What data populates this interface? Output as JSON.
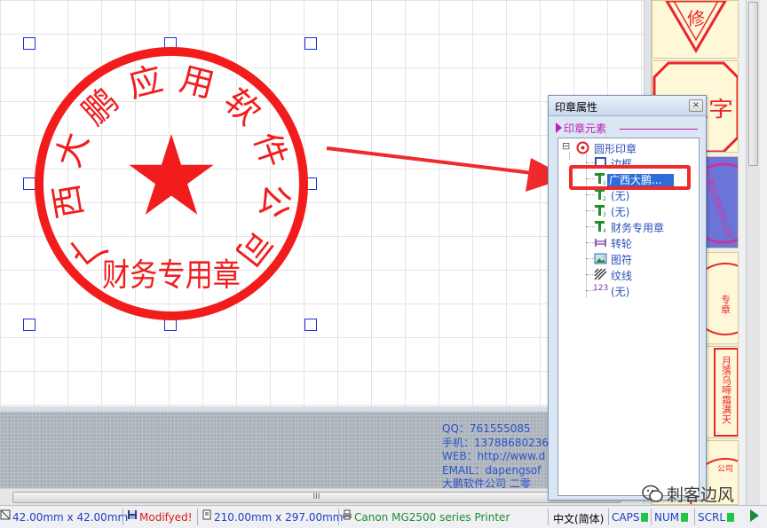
{
  "canvas": {
    "seal": {
      "arc_text": "广西大鹏应用软件公司",
      "center_symbol": "★",
      "bottom_text": "财务专用章",
      "color": "#f21c1c"
    }
  },
  "background_info": [
    "QQ：761555085",
    "手机：13788680236",
    "WEB：http://www.d",
    "EMAIL：dapengsof",
    "大鹏软件公司 二零"
  ],
  "gallery": {
    "tiles": [
      {
        "name": "diamond-stamp",
        "text": "修"
      },
      {
        "name": "octagon-name-stamp",
        "text": "名姓字"
      },
      {
        "name": "round-blue-stamp",
        "text": "大鹏应用软件公司",
        "selected": true
      },
      {
        "name": "small-round-stamp",
        "text": "专章"
      },
      {
        "name": "poem-stamp",
        "text": "月落乌啼霜满天"
      },
      {
        "name": "bottom-stamp",
        "text": "公司"
      }
    ]
  },
  "panel": {
    "title": "印章属性",
    "close_label": "×",
    "section_label": "印章元素",
    "tree": {
      "root": {
        "label": "圆形印章",
        "expander": "⊟"
      },
      "items": [
        {
          "icon": "border-icon",
          "label": "边框"
        },
        {
          "icon": "text-1-icon",
          "label": "广西大鹏...",
          "editing": true
        },
        {
          "icon": "text-2-icon",
          "label": "(无)"
        },
        {
          "icon": "text-3-icon",
          "label": "(无)"
        },
        {
          "icon": "text-4-icon",
          "label": "财务专用章"
        },
        {
          "icon": "wheel-icon",
          "label": "转轮"
        },
        {
          "icon": "image-icon",
          "label": "图符"
        },
        {
          "icon": "hatch-icon",
          "label": "纹线"
        },
        {
          "icon": "number-icon",
          "label": "(无)",
          "icon_text": "123"
        }
      ]
    }
  },
  "scrollbar": {
    "grip": "III"
  },
  "status_bar": {
    "seal_size": "42.00mm x 42.00mm",
    "modified": "Modifyed!",
    "page_size": "210.00mm x 297.00mm",
    "printer": "Canon MG2500 series Printer",
    "ime": "中文(简体)",
    "caps": "CAPS",
    "num": "NUM",
    "scrl": "SCRL"
  },
  "watermark": {
    "text": "刺客边风"
  },
  "colors": {
    "seal_red": "#f21c1c",
    "arrow_red": "#ee2a2a",
    "tree_text": "#2b4fb8",
    "section_magenta": "#c21bb0",
    "selection_blue": "#2f6cd9",
    "led_green": "#22c44a"
  }
}
